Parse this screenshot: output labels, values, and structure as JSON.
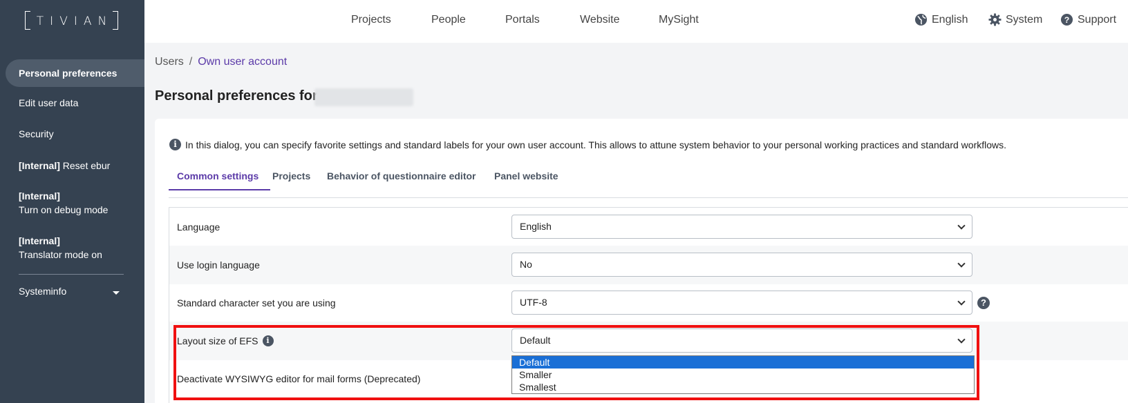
{
  "brand": {
    "logo_text": "TIVIAN"
  },
  "sidebar": {
    "items": [
      {
        "label": "Personal preferences"
      },
      {
        "label": "Edit user data"
      },
      {
        "label": "Security"
      },
      {
        "prefix": "[Internal]",
        "label": "Reset ebur"
      },
      {
        "prefix": "[Internal]",
        "label": "Turn on debug mode"
      },
      {
        "prefix": "[Internal]",
        "label": "Translator mode on"
      },
      {
        "label": "Systeminfo"
      }
    ]
  },
  "topnav": {
    "items": [
      "Projects",
      "People",
      "Portals",
      "Website",
      "MySight"
    ],
    "right": {
      "language": "English",
      "system": "System",
      "support": "Support"
    }
  },
  "breadcrumb": {
    "root": "Users",
    "separator": "/",
    "current": "Own user account"
  },
  "page": {
    "title": "Personal preferences for"
  },
  "info": {
    "text": "In this dialog, you can specify favorite settings and standard labels for your own user account. This allows to attune system behavior to your personal working practices and standard workflows."
  },
  "tabs": [
    "Common settings",
    "Projects",
    "Behavior of questionnaire editor",
    "Panel website"
  ],
  "settings": [
    {
      "label": "Language",
      "value": "English"
    },
    {
      "label": "Use login language",
      "value": "No"
    },
    {
      "label": "Standard character set you are using",
      "value": "UTF-8"
    },
    {
      "label": "Layout size of EFS",
      "value": "Default"
    },
    {
      "label": "Deactivate WYSIWYG editor for mail forms (Deprecated)"
    }
  ],
  "dropdown": {
    "options": [
      "Default",
      "Smaller",
      "Smallest"
    ],
    "selected": "Default"
  },
  "colors": {
    "sidebar": "#354251",
    "accent": "#5b3aa8",
    "highlight": "#f01010",
    "selected_option": "#1a6fd6"
  }
}
